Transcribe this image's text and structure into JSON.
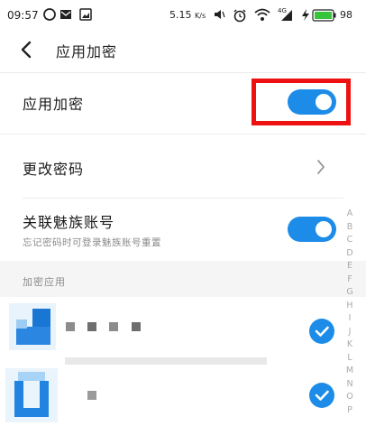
{
  "status_bar": {
    "time": "09:57",
    "net_speed": "5.15",
    "net_speed_unit": "K/s",
    "battery": "98",
    "signal": "4G"
  },
  "header": {
    "title": "应用加密",
    "back_icon": "chevron-left-icon"
  },
  "settings": {
    "app_lock": {
      "label": "应用加密",
      "enabled": true
    },
    "change_password": {
      "label": "更改密码"
    },
    "link_account": {
      "label": "关联魅族账号",
      "description": "忘记密码时可登录魅族账号重置",
      "enabled": true
    }
  },
  "section": {
    "title": "加密应用"
  },
  "index_letters": [
    "A",
    "B",
    "C",
    "D",
    "E",
    "F",
    "G",
    "H",
    "I",
    "J",
    "K",
    "L",
    "M",
    "N",
    "O",
    "P"
  ],
  "apps": [
    {
      "icon": "app-icon",
      "locked": true
    },
    {
      "icon": "app-icon",
      "locked": true
    }
  ],
  "colors": {
    "accent": "#1d8ce8",
    "highlight": "#ee1111",
    "battery": "#35c43a"
  }
}
